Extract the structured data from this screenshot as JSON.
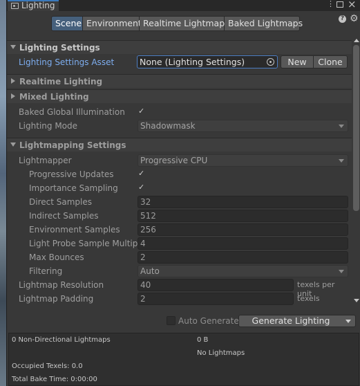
{
  "window": {
    "tab_title": "Lighting"
  },
  "tabs": [
    {
      "label": "Scene",
      "active": true
    },
    {
      "label": "Environment",
      "active": false
    },
    {
      "label": "Realtime Lightmaps",
      "active": false
    },
    {
      "label": "Baked Lightmaps",
      "active": false
    }
  ],
  "lighting_settings": {
    "header": "Lighting Settings",
    "asset_label": "Lighting Settings Asset",
    "asset_value": "None (Lighting Settings)",
    "new_label": "New",
    "clone_label": "Clone"
  },
  "realtime_lighting": {
    "header": "Realtime Lighting"
  },
  "mixed_lighting": {
    "header": "Mixed Lighting",
    "baked_gi_label": "Baked Global Illumination",
    "baked_gi_checked": true,
    "mode_label": "Lighting Mode",
    "mode_value": "Shadowmask"
  },
  "lightmapping": {
    "header": "Lightmapping Settings",
    "lightmapper_label": "Lightmapper",
    "lightmapper_value": "Progressive CPU",
    "progressive_updates_label": "Progressive Updates",
    "progressive_updates_checked": true,
    "importance_sampling_label": "Importance Sampling",
    "importance_sampling_checked": true,
    "direct_samples_label": "Direct Samples",
    "direct_samples_value": "32",
    "indirect_samples_label": "Indirect Samples",
    "indirect_samples_value": "512",
    "environment_samples_label": "Environment Samples",
    "environment_samples_value": "256",
    "light_probe_label": "Light Probe Sample Multiplier",
    "light_probe_value": "4",
    "max_bounces_label": "Max Bounces",
    "max_bounces_value": "2",
    "filtering_label": "Filtering",
    "filtering_value": "Auto",
    "resolution_label": "Lightmap Resolution",
    "resolution_value": "40",
    "resolution_unit": "texels per unit",
    "padding_label": "Lightmap Padding",
    "padding_value": "2",
    "padding_unit": "texels"
  },
  "bake": {
    "auto_generate_label": "Auto Generate",
    "auto_generate_checked": false,
    "generate_label": "Generate Lighting"
  },
  "stats": {
    "lightmaps": "0 Non-Directional Lightmaps",
    "size": "0 B",
    "no_lightmaps": "No Lightmaps",
    "occupied_texels": "Occupied Texels: 0.0",
    "total_bake_time": "Total Bake Time: 0:00:00"
  }
}
